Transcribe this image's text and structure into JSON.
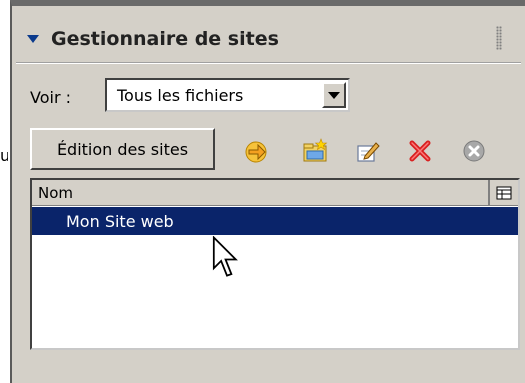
{
  "panel": {
    "title": "Gestionnaire de sites",
    "cut_text": "ur"
  },
  "filter": {
    "label": "Voir :",
    "selected": "Tous les fichiers"
  },
  "toolbar": {
    "edit_sites_label": "Édition des sites",
    "icons": [
      "connect-icon",
      "new-site-icon",
      "edit-icon",
      "delete-icon",
      "stop-icon"
    ]
  },
  "list": {
    "column_header": "Nom",
    "rows": [
      {
        "label": "Mon Site web",
        "selected": true
      }
    ]
  },
  "colors": {
    "panel_bg": "#d4d0c8",
    "selection": "#0a246a",
    "title_triangle": "#0b3a8c"
  }
}
